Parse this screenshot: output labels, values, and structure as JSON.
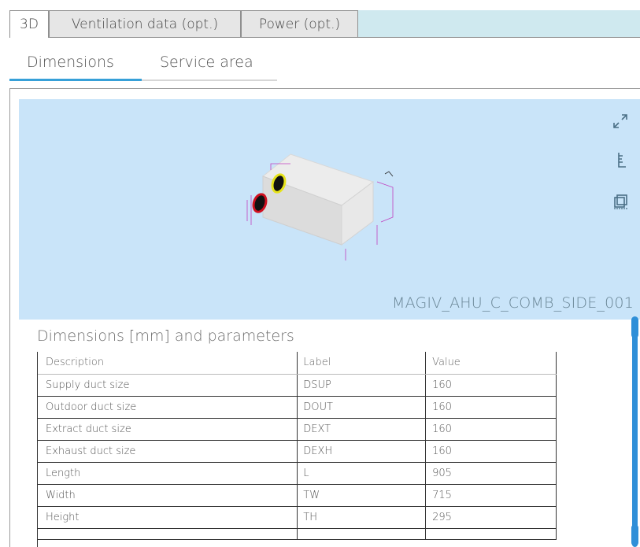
{
  "top_tabs": [
    {
      "label": "3D",
      "active": true
    },
    {
      "label": "Ventilation data (opt.)",
      "active": false
    },
    {
      "label": "Power (opt.)",
      "active": false
    }
  ],
  "sub_tabs": [
    {
      "label": "Dimensions",
      "active": true
    },
    {
      "label": "Service area",
      "active": false
    }
  ],
  "viewer": {
    "model_name": "MAGIV_AHU_C_COMB_SIDE_001",
    "background": "#c9e4f9",
    "icons": [
      "expand-icon",
      "ruler-icon",
      "cube-view-icon"
    ]
  },
  "params": {
    "title": "Dimensions [mm] and parameters",
    "columns": [
      "Description",
      "Label",
      "Value"
    ],
    "rows": [
      {
        "description": "Supply duct size",
        "label": "DSUP",
        "value": "160"
      },
      {
        "description": "Outdoor duct size",
        "label": "DOUT",
        "value": "160"
      },
      {
        "description": "Extract duct size",
        "label": "DEXT",
        "value": "160"
      },
      {
        "description": "Exhaust duct size",
        "label": "DEXH",
        "value": "160"
      },
      {
        "description": "Length",
        "label": "L",
        "value": "905"
      },
      {
        "description": "Width",
        "label": "TW",
        "value": "715"
      },
      {
        "description": "Height",
        "label": "TH",
        "value": "295"
      }
    ]
  },
  "colors": {
    "accent": "#37a0d8",
    "tab_strip": "#cfe9ef",
    "scrollbar": "#2f8fd8"
  }
}
